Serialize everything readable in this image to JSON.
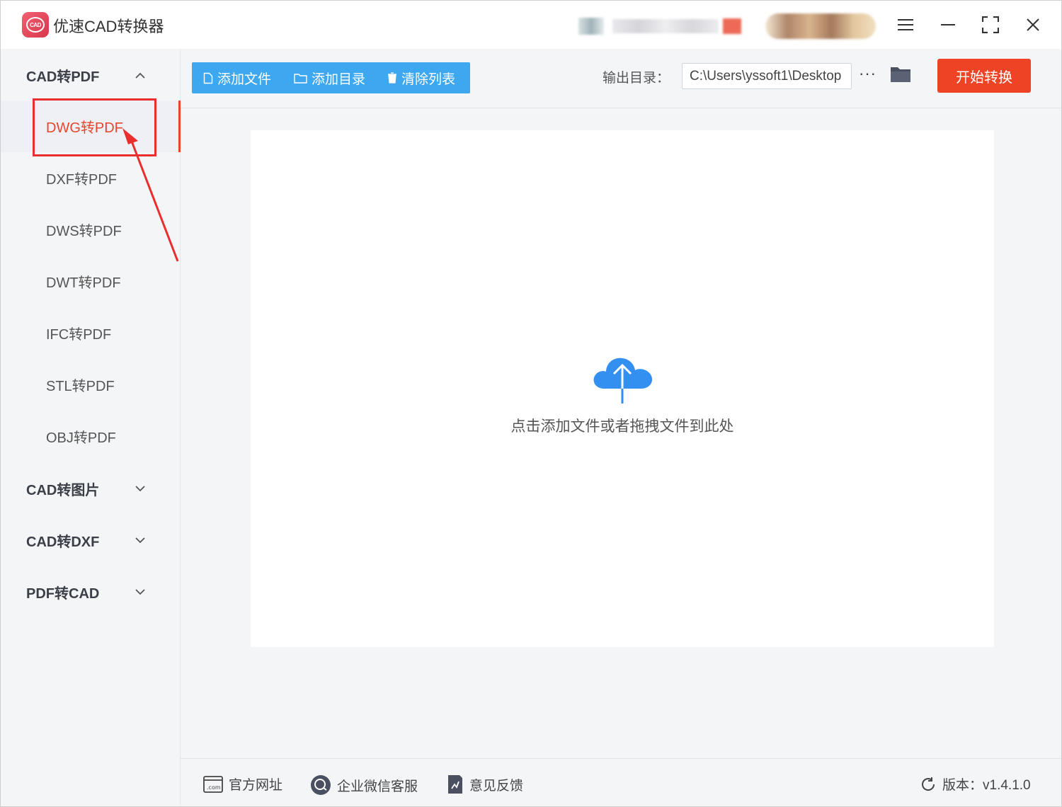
{
  "app": {
    "title": "优速CAD转换器",
    "logo_text": "CAD"
  },
  "sidebar": {
    "groups": [
      {
        "label": "CAD转PDF",
        "expanded": true,
        "items": [
          {
            "label": "DWG转PDF",
            "active": true
          },
          {
            "label": "DXF转PDF"
          },
          {
            "label": "DWS转PDF"
          },
          {
            "label": "DWT转PDF"
          },
          {
            "label": "IFC转PDF"
          },
          {
            "label": "STL转PDF"
          },
          {
            "label": "OBJ转PDF"
          }
        ]
      },
      {
        "label": "CAD转图片",
        "expanded": false
      },
      {
        "label": "CAD转DXF",
        "expanded": false
      },
      {
        "label": "PDF转CAD",
        "expanded": false
      }
    ]
  },
  "toolbar": {
    "add_file": "添加文件",
    "add_dir": "添加目录",
    "clear_list": "清除列表",
    "output_label": "输出目录：",
    "output_path": "C:\\Users\\yssoft1\\Desktop",
    "more": "···",
    "start": "开始转换"
  },
  "dropzone": {
    "hint": "点击添加文件或者拖拽文件到此处"
  },
  "footer": {
    "website": "官方网址",
    "wechat": "企业微信客服",
    "feedback": "意见反馈",
    "version": "版本：v1.4.1.0"
  },
  "colors": {
    "accent": "#ee4324",
    "primary": "#3da8f0",
    "active_text": "#e8452c",
    "annotation": "#ea2e2e"
  }
}
